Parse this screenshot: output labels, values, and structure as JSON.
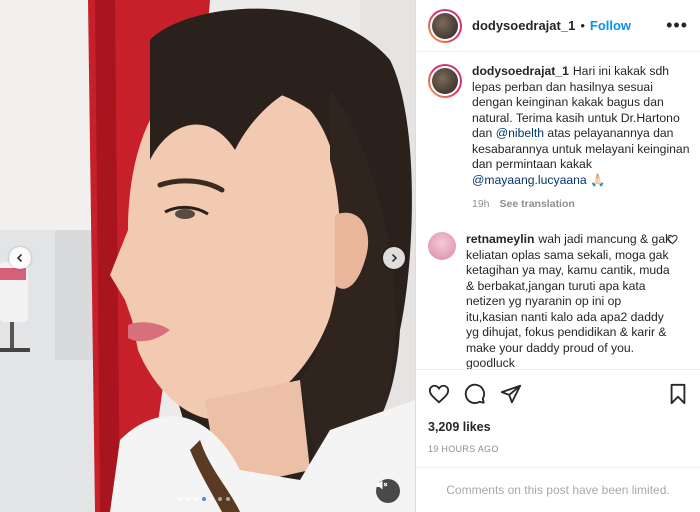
{
  "post": {
    "username": "dodysoedrajat_1",
    "follow_label": "Follow",
    "separator": "•",
    "more_label": "•••",
    "carousel_dots": 7,
    "active_dot": 3
  },
  "caption": {
    "username": "dodysoedrajat_1",
    "text_1": "Hari ini kakak sdh lepas perban dan hasilnya sesuai dengan keinginan kakak bagus dan natural. Terima kasih untuk Dr.Hartono dan ",
    "mention_1": "@nibelth",
    "text_2": " atas pelayanannya dan kesabarannya untuk melayani keinginan dan permintaan kakak ",
    "mention_2": "@mayaang.lucyaana",
    "text_3": " 🙏🏻",
    "time": "19h",
    "see_translation": "See translation"
  },
  "comment": {
    "username": "retnameylin",
    "text": "wah jadi mancung & gak keliatan oplas sama sekali, moga gak ketagihan ya may, kamu cantik, muda & berbakat,jangan turuti apa kata netizen yg nyaranin op ini op itu,kasian nanti kalo ada apa2 daddy yg dihujat, fokus pendidikan & karir & make your daddy proud of you. goodluck"
  },
  "stats": {
    "likes": "3,209 likes",
    "posted": "19 HOURS AGO"
  },
  "footer": {
    "text": "Comments on this post have been limited."
  },
  "colors": {
    "accent": "#0095f6",
    "mention": "#00376b",
    "muted": "#8e8e8e"
  }
}
